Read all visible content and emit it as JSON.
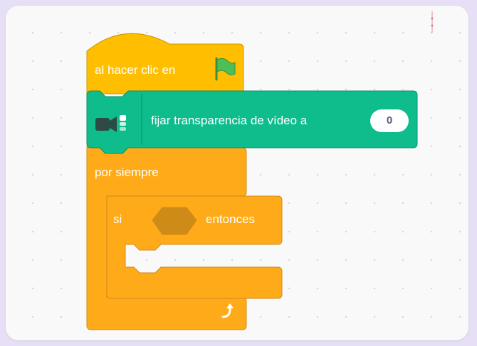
{
  "colors": {
    "events": "#ffbf00",
    "events_border": "#cc9900",
    "control": "#ffab19",
    "control_border": "#cf8b17",
    "video_sensing": "#0fbd8c",
    "video_sensing_border": "#0b8e69",
    "flag": "#4cbf56",
    "workspace": "#f9f9f9"
  },
  "blocks": {
    "hat": {
      "label": "al hacer clic en",
      "icon": "green-flag-icon"
    },
    "video_transparency": {
      "icon": "video-camera-icon",
      "label": "fijar transparencia de vídeo a",
      "value": "0"
    },
    "forever": {
      "label": "por siempre",
      "icon": "loop-arrow-icon"
    },
    "if_then": {
      "label_if": "si",
      "label_then": "entonces"
    }
  }
}
